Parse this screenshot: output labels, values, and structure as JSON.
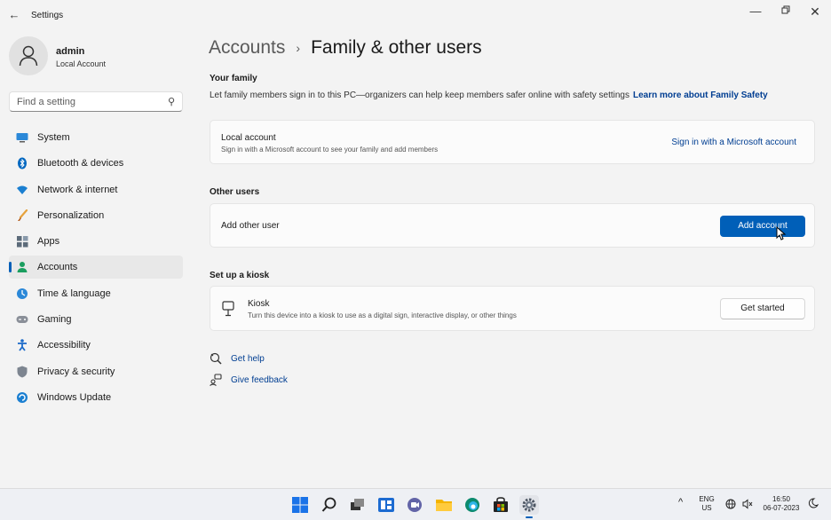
{
  "titlebar": {
    "app_title": "Settings"
  },
  "profile": {
    "name": "admin",
    "account_type": "Local Account"
  },
  "search": {
    "placeholder": "Find a setting"
  },
  "nav": {
    "items": [
      {
        "label": "System",
        "icon": "monitor-icon"
      },
      {
        "label": "Bluetooth & devices",
        "icon": "bluetooth-icon"
      },
      {
        "label": "Network & internet",
        "icon": "wifi-icon"
      },
      {
        "label": "Personalization",
        "icon": "brush-icon"
      },
      {
        "label": "Apps",
        "icon": "apps-icon"
      },
      {
        "label": "Accounts",
        "icon": "person-icon",
        "selected": true
      },
      {
        "label": "Time & language",
        "icon": "globe-clock-icon"
      },
      {
        "label": "Gaming",
        "icon": "gamepad-icon"
      },
      {
        "label": "Accessibility",
        "icon": "accessibility-icon"
      },
      {
        "label": "Privacy & security",
        "icon": "shield-icon"
      },
      {
        "label": "Windows Update",
        "icon": "update-icon"
      }
    ]
  },
  "breadcrumb": {
    "parent": "Accounts",
    "separator": "›",
    "current": "Family & other users"
  },
  "your_family": {
    "heading": "Your family",
    "description": "Let family members sign in to this PC—organizers can help keep members safer online with safety settings",
    "link": "Learn more about Family Safety",
    "card": {
      "title": "Local account",
      "subtitle": "Sign in with a Microsoft account to see your family and add members",
      "action": "Sign in with a Microsoft account"
    }
  },
  "other_users": {
    "heading": "Other users",
    "card": {
      "title": "Add other user",
      "button": "Add account"
    }
  },
  "kiosk": {
    "heading": "Set up a kiosk",
    "card": {
      "title": "Kiosk",
      "subtitle": "Turn this device into a kiosk to use as a digital sign, interactive display, or other things",
      "button": "Get started"
    }
  },
  "help": {
    "get_help": "Get help",
    "give_feedback": "Give feedback"
  },
  "taskbar": {
    "language": "ENG",
    "region": "US",
    "time": "16:50",
    "date": "06-07-2023"
  },
  "colors": {
    "accent": "#005fb8",
    "link": "#003e92",
    "background": "#f3f3f3"
  }
}
